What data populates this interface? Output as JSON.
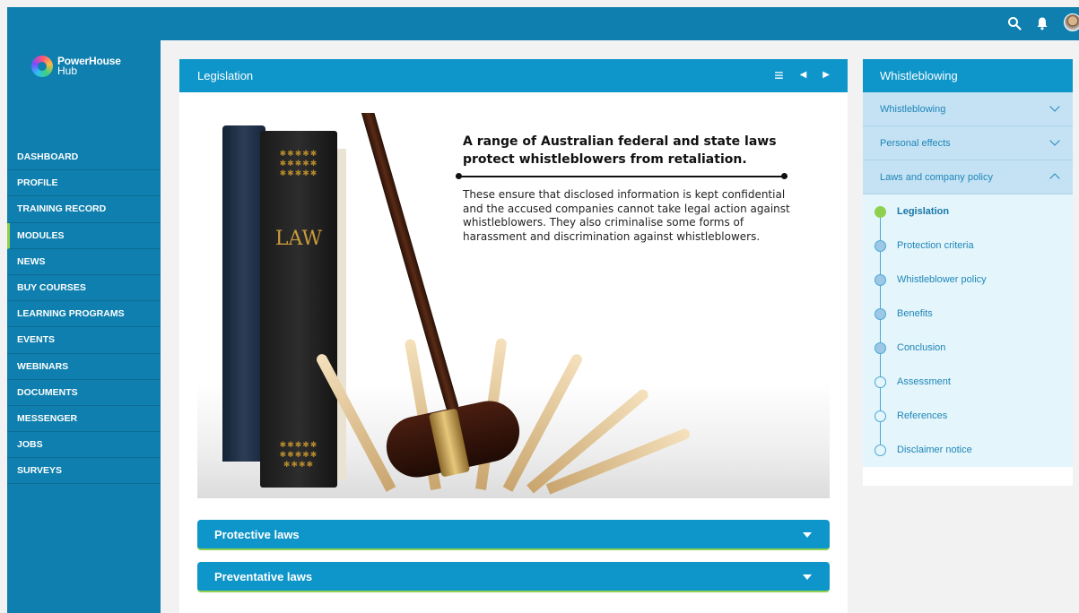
{
  "brand": {
    "line1": "PowerHouse",
    "line2": "Hub"
  },
  "nav": [
    "DASHBOARD",
    "PROFILE",
    "TRAINING RECORD",
    "MODULES",
    "NEWS",
    "BUY COURSES",
    "LEARNING PROGRAMS",
    "EVENTS",
    "WEBINARS",
    "DOCUMENTS",
    "MESSENGER",
    "JOBS",
    "SURVEYS"
  ],
  "active_nav": "MODULES",
  "topbar": {
    "icons": [
      "search-icon",
      "bell-icon",
      "avatar"
    ]
  },
  "panel": {
    "title": "Legislation",
    "icons": {
      "menu": "≡",
      "prev": "◀",
      "next": "▶"
    }
  },
  "hero": {
    "title": "A range of Australian federal and state laws protect whistleblowers from retaliation.",
    "body": "These ensure that disclosed information is kept confidential and the accused companies cannot take legal action against whistleblowers. They also criminalise some forms of harassment and discrimination against whistleblowers.",
    "book_label": "LAW"
  },
  "accordions": [
    "Protective laws",
    "Preventative laws"
  ],
  "right_panel": {
    "title": "Whistleblowing",
    "sections": [
      "Whistleblowing",
      "Personal effects",
      "Laws and company policy"
    ],
    "items": [
      "Legislation",
      "Protection criteria",
      "Whistleblower policy",
      "Benefits",
      "Conclusion",
      "Assessment",
      "References",
      "Disclaimer notice"
    ]
  },
  "colors": {
    "primary": "#0e95c9",
    "sidebar": "#0e7fae",
    "accent": "#8fd14f"
  }
}
